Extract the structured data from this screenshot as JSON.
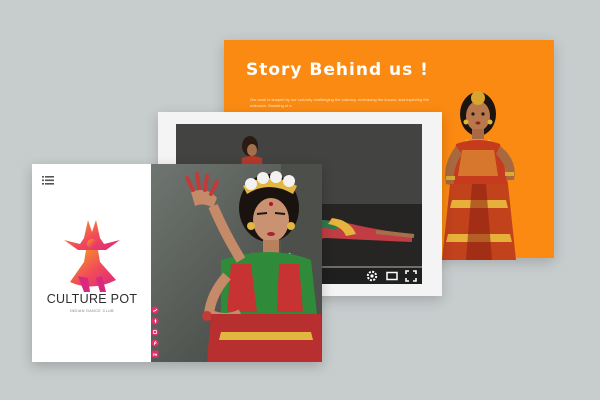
{
  "story_card": {
    "title": "Story Behind us !",
    "paragraph": "Our work is shaped by our curiosity challenging the ordinary, embracing the known, and exploring the unknown. Boasting of a"
  },
  "video_card": {
    "progress": 0.3,
    "controls": [
      "settings-icon",
      "theater-mode-icon",
      "fullscreen-icon"
    ]
  },
  "site_card": {
    "brand_name": "CULTURE POT",
    "brand_subtitle": "INDIAN DANCE CLUB",
    "menu_icon": "hamburger-icon",
    "social_icons": [
      "twitter-icon",
      "facebook-icon",
      "instagram-icon",
      "pinterest-icon",
      "linkedin-icon"
    ]
  },
  "colors": {
    "accent_orange": "#fb8a12",
    "social_pink": "#e1306c",
    "background": "#c7cccd"
  }
}
